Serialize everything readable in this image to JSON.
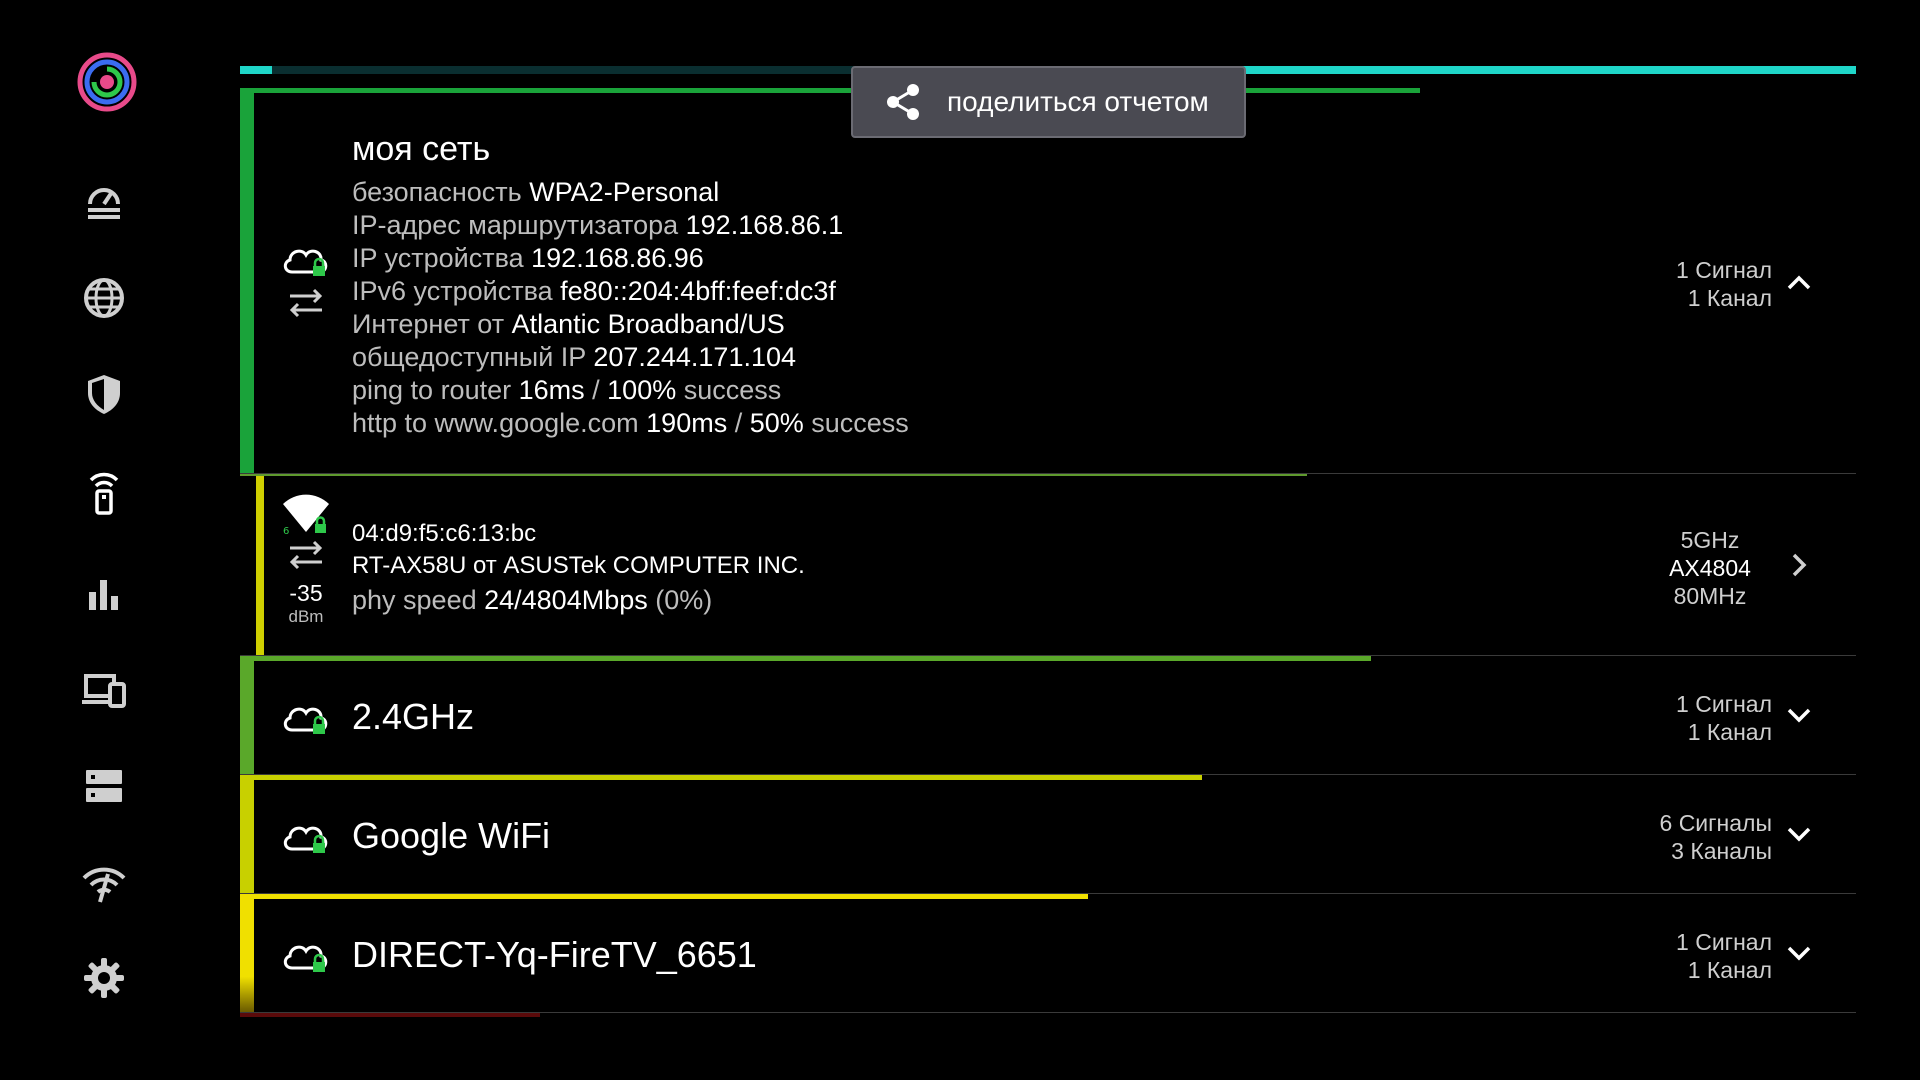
{
  "share": {
    "label": "поделиться отчетом"
  },
  "progress": {
    "segments": [
      {
        "from": 0.0,
        "to": 0.02
      },
      {
        "from": 0.535,
        "to": 1.0
      }
    ]
  },
  "sidebar": {
    "items": [
      {
        "icon": "speedometer-icon"
      },
      {
        "icon": "globe-icon"
      },
      {
        "icon": "shield-icon"
      },
      {
        "icon": "wifi-remote-icon",
        "active": true
      },
      {
        "icon": "bar-chart-icon"
      },
      {
        "icon": "devices-icon"
      },
      {
        "icon": "server-icon"
      },
      {
        "icon": "wifi-off-icon"
      },
      {
        "icon": "gear-icon"
      }
    ]
  },
  "networks": {
    "my_network": {
      "title": "моя сеть",
      "details": [
        {
          "label": "безопасность ",
          "value": "WPA2-Personal"
        },
        {
          "label": "IP-адрес маршрутизатора ",
          "value": "192.168.86.1"
        },
        {
          "label": "IP устройства ",
          "value": "192.168.86.96"
        },
        {
          "label": "IPv6 устройства ",
          "value": "fe80::204:4bff:feef:dc3f"
        },
        {
          "label": "Интернет от ",
          "value": "Atlantic Broadband/US"
        },
        {
          "label": "общедоступный IP ",
          "value": "207.244.171.104"
        }
      ],
      "ping": {
        "label": "ping to router ",
        "ms": "16ms",
        "sep": " / ",
        "pct": "100%",
        "suffix": " success"
      },
      "http": {
        "label": "http to www.google.com ",
        "ms": "190ms",
        "sep": " / ",
        "pct": "50%",
        "suffix": " success"
      },
      "signals": "1 Сигнал",
      "channels": "1 Канал",
      "color": "#1aa33a",
      "top_fill": 0.73
    },
    "access_point": {
      "mac": "04:d9:f5:c6:13:bc",
      "vendor": "RT-AX58U от ASUSTek COMPUTER INC.",
      "phy_label": "phy speed ",
      "phy_value": "24/4804Mbps",
      "phy_pct": " (0%)",
      "dbm_value": "-35",
      "dbm_unit": "dBm",
      "band": "5GHz",
      "standard": "AX4804",
      "width": "80MHz",
      "color": "#d0d000",
      "top_fill": 0.66
    },
    "groups": [
      {
        "title": "2.4GHz",
        "signals": "1 Сигнал",
        "channels": "1 Канал",
        "color": "#5aa82a",
        "top_fill": 0.7
      },
      {
        "title": "Google WiFi",
        "signals": "6 Сигналы",
        "channels": "3 Каналы",
        "color": "#c8d000",
        "top_fill": 0.595
      },
      {
        "title": "DIRECT-Yq-FireTV_6651",
        "signals": "1 Сигнал",
        "channels": "1 Канал",
        "color": "#f0e000",
        "top_fill": 0.525
      }
    ]
  }
}
